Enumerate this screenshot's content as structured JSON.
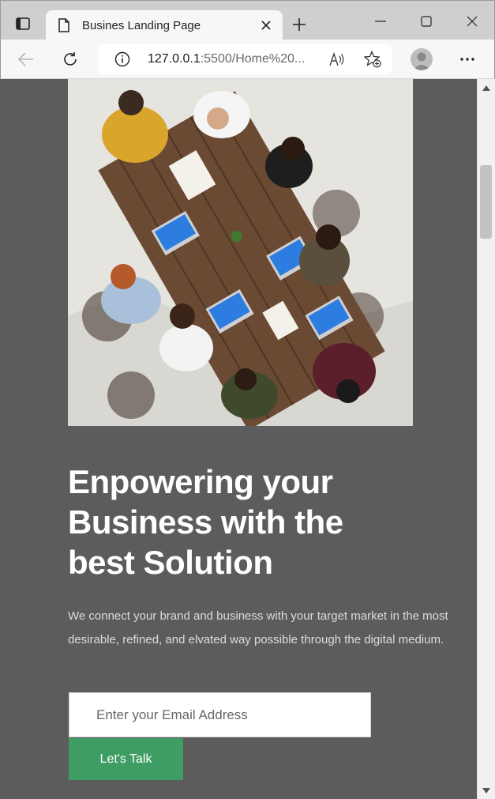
{
  "browser": {
    "tab_title": "Busines Landing Page",
    "url_host": "127.0.0.1",
    "url_rest": ":5500/Home%20..."
  },
  "page": {
    "heading": "Enpowering your Business with the best Solution",
    "description": "We connect your brand and business with your target market in the most desirable, refined, and elvated way possible through the digital medium.",
    "email_placeholder": "Enter your Email Address",
    "cta_label": "Let's Talk"
  },
  "colors": {
    "page_background": "#5c5c5c",
    "cta_green": "#3e9d63",
    "heading_text": "#ffffff"
  },
  "icons": {
    "tab_actions": "tab-actions-icon",
    "tab_page": "document-icon",
    "tab_close": "close-icon",
    "new_tab": "plus-icon",
    "minimize": "minimize-icon",
    "maximize": "maximize-icon",
    "window_close": "close-icon",
    "back": "arrow-left-icon",
    "reload": "reload-icon",
    "site_info": "info-icon",
    "read_aloud": "read-aloud-icon",
    "favorites": "star-plus-icon",
    "profile": "avatar-icon",
    "more": "more-dots-icon",
    "visual_search": "visual-search-icon"
  }
}
